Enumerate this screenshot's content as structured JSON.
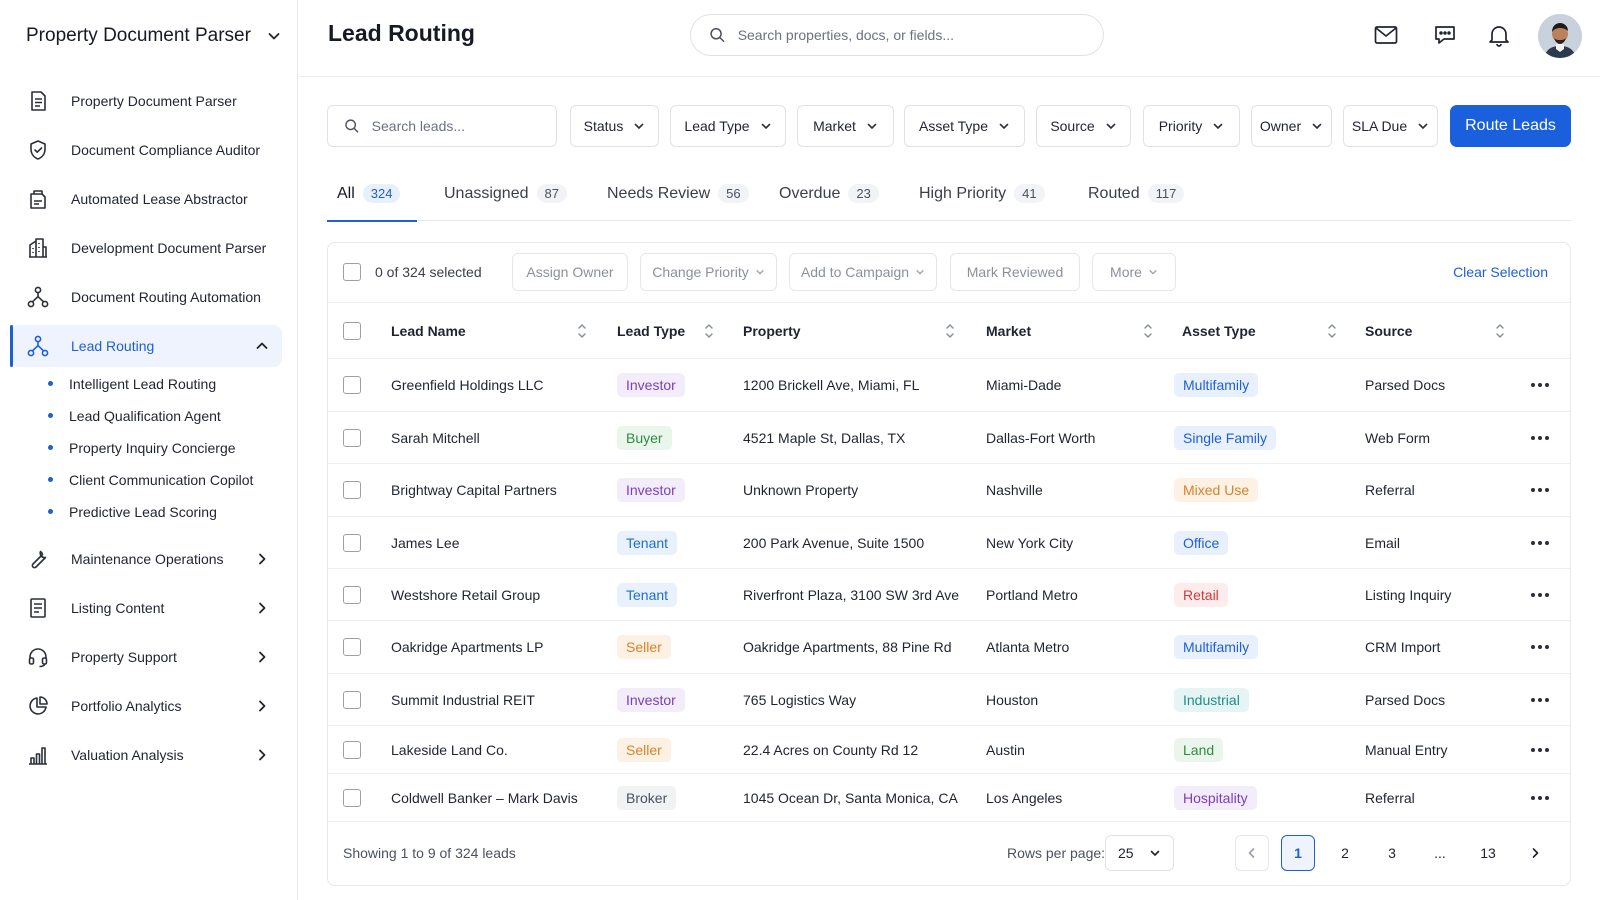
{
  "app": {
    "name": "Property Document Parser"
  },
  "sidebar": {
    "items": [
      {
        "label": "Property Document Parser",
        "icon": "document-icon"
      },
      {
        "label": "Document Compliance Auditor",
        "icon": "shield-check-icon"
      },
      {
        "label": "Automated Lease Abstractor",
        "icon": "lease-icon"
      },
      {
        "label": "Development Document Parser",
        "icon": "building-icon"
      },
      {
        "label": "Document Routing Automation",
        "icon": "routing-icon"
      },
      {
        "label": "Lead Routing",
        "icon": "lead-routing-icon",
        "active": true,
        "expanded": true
      },
      {
        "label": "Maintenance Operations",
        "icon": "wrench-icon"
      },
      {
        "label": "Listing Content",
        "icon": "listing-icon"
      },
      {
        "label": "Property Support",
        "icon": "headset-icon"
      },
      {
        "label": "Portfolio Analytics",
        "icon": "pie-chart-icon"
      },
      {
        "label": "Valuation Analysis",
        "icon": "bar-chart-icon"
      }
    ],
    "sub_items": [
      "Intelligent Lead Routing",
      "Lead Qualification Agent",
      "Property Inquiry Concierge",
      "Client Communication Copilot",
      "Predictive Lead Scoring"
    ]
  },
  "header": {
    "title": "Lead Routing",
    "search_placeholder": "Search properties, docs, or fields..."
  },
  "filters": {
    "search_placeholder": "Search leads...",
    "dropdowns": [
      "Status",
      "Lead Type",
      "Market",
      "Asset Type",
      "Source",
      "Priority",
      "Owner",
      "SLA Due"
    ],
    "primary_action": "Route Leads"
  },
  "tabs": [
    {
      "label": "All",
      "count": "324",
      "active": true
    },
    {
      "label": "Unassigned",
      "count": "87"
    },
    {
      "label": "Needs Review",
      "count": "56"
    },
    {
      "label": "Overdue",
      "count": "23"
    },
    {
      "label": "High Priority",
      "count": "41"
    },
    {
      "label": "Routed",
      "count": "117"
    }
  ],
  "bulk": {
    "selected_text": "0 of 324 selected",
    "actions": [
      "Assign Owner",
      "Change Priority",
      "Add to Campaign",
      "Mark Reviewed",
      "More"
    ],
    "clear_selection": "Clear Selection"
  },
  "table": {
    "columns": [
      "Lead Name",
      "Lead Type",
      "Property",
      "Market",
      "Asset Type",
      "Source"
    ],
    "rows": [
      {
        "name": "Greenfield Holdings LLC",
        "type": "Investor",
        "property": "1200 Brickell Ave, Miami, FL",
        "market": "Miami-Dade",
        "asset": "Multifamily",
        "source": "Parsed Docs"
      },
      {
        "name": "Sarah Mitchell",
        "type": "Buyer",
        "property": "4521 Maple St, Dallas, TX",
        "market": "Dallas-Fort Worth",
        "asset": "Single Family",
        "source": "Web Form"
      },
      {
        "name": "Brightway Capital Partners",
        "type": "Investor",
        "property": "Unknown Property",
        "market": "Nashville",
        "asset": "Mixed Use",
        "source": "Referral"
      },
      {
        "name": "James Lee",
        "type": "Tenant",
        "property": "200 Park Avenue, Suite 1500",
        "market": "New York City",
        "asset": "Office",
        "source": "Email"
      },
      {
        "name": "Westshore Retail Group",
        "type": "Tenant",
        "property": "Riverfront Plaza, 3100 SW 3rd Ave",
        "market": "Portland Metro",
        "asset": "Retail",
        "source": "Listing Inquiry"
      },
      {
        "name": "Oakridge Apartments LP",
        "type": "Seller",
        "property": "Oakridge Apartments, 88 Pine Rd",
        "market": "Atlanta Metro",
        "asset": "Multifamily",
        "source": "CRM Import"
      },
      {
        "name": "Summit Industrial REIT",
        "type": "Investor",
        "property": "765 Logistics Way",
        "market": "Houston",
        "asset": "Industrial",
        "source": "Parsed Docs"
      },
      {
        "name": "Lakeside Land Co.",
        "type": "Seller",
        "property": "22.4 Acres on County Rd 12",
        "market": "Austin",
        "asset": "Land",
        "source": "Manual Entry"
      },
      {
        "name": "Coldwell Banker – Mark Davis",
        "type": "Broker",
        "property": "1045 Ocean Dr, Santa Monica, CA",
        "market": "Los Angeles",
        "asset": "Hospitality",
        "source": "Referral"
      }
    ]
  },
  "pagination": {
    "showing": "Showing 1 to 9 of 324 leads",
    "rows_per_page_label": "Rows per page:",
    "rows_per_page": "25",
    "pages": [
      "1",
      "2",
      "3",
      "...",
      "13"
    ],
    "current_page": "1"
  },
  "colors": {
    "accent": "#1a5fdc",
    "investor": "#7b3fb8",
    "buyer": "#2e8b3f",
    "tenant": "#1f6fd0",
    "seller": "#d9822b",
    "broker": "#4b5160",
    "multifamily": "#1f5fd6",
    "mixed_use": "#d9822b",
    "retail": "#d03a3a",
    "industrial": "#1f8f8a",
    "land": "#2e8b3f",
    "hospitality": "#7b3fb8"
  }
}
